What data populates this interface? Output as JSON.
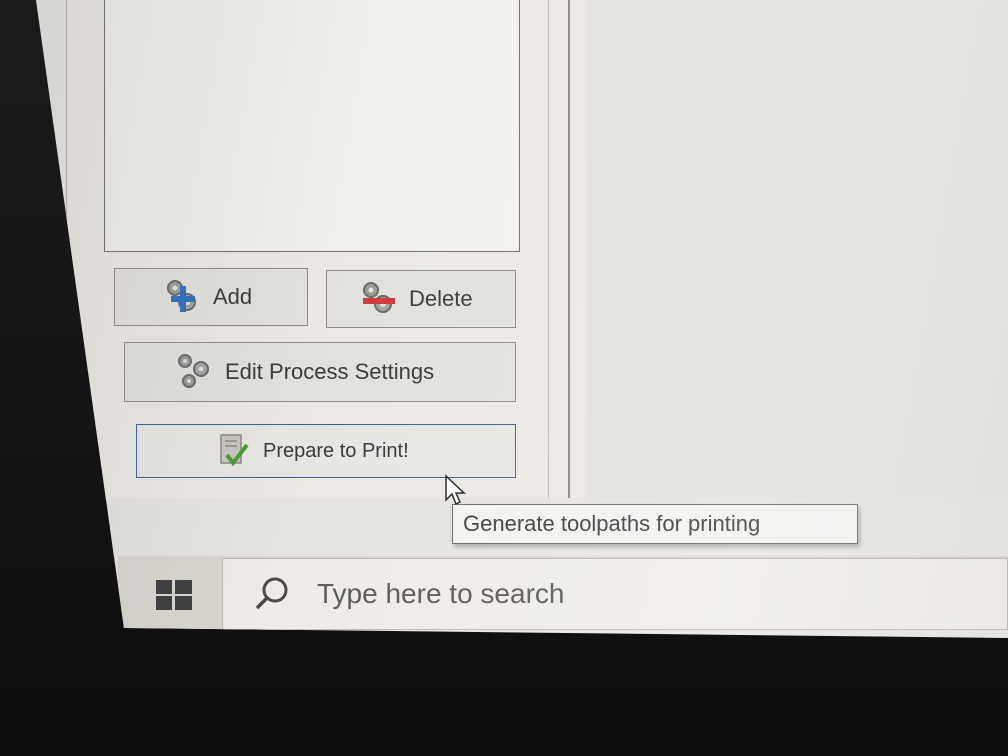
{
  "buttons": {
    "add_label": "Add",
    "delete_label": "Delete",
    "edit_process_settings_label": "Edit Process Settings",
    "prepare_to_print_label": "Prepare to Print!"
  },
  "tooltip": {
    "text": "Generate toolpaths for printing"
  },
  "taskbar": {
    "search_placeholder": "Type here to search",
    "start_icon": "windows-logo-icon",
    "search_icon": "search-icon"
  },
  "colors": {
    "primary_button_border": "#3f5f9a",
    "add_icon_accent": "#2f6fbf",
    "delete_icon_accent": "#d23a3a",
    "checkmark_accent": "#4a9a3a"
  }
}
